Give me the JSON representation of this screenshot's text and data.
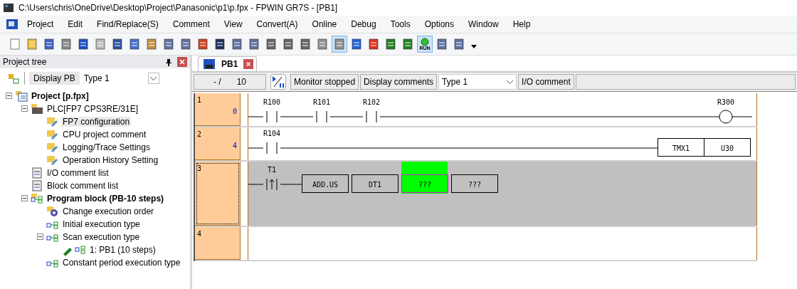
{
  "window": {
    "title": "C:\\Users\\chris\\OneDrive\\Desktop\\Project\\Panasonic\\p1\\p.fpx - FPWIN GR7S - [PB1]"
  },
  "menu": [
    "Project",
    "Edit",
    "Find/Replace(S)",
    "Comment",
    "View",
    "Convert(A)",
    "Online",
    "Debug",
    "Tools",
    "Options",
    "Window",
    "Help"
  ],
  "toolbar": [
    {
      "kind": "new",
      "pressed": false
    },
    {
      "kind": "open",
      "pressed": false
    },
    {
      "kind": "save",
      "pressed": false
    },
    {
      "kind": "print",
      "pressed": false
    },
    {
      "kind": "undo",
      "pressed": false
    },
    {
      "kind": "redo",
      "pressed": false
    },
    {
      "kind": "cut",
      "pressed": false
    },
    {
      "kind": "copy",
      "pressed": false
    },
    {
      "kind": "paste",
      "pressed": false
    },
    {
      "kind": "list",
      "pressed": false
    },
    {
      "kind": "list",
      "pressed": false
    },
    {
      "kind": "swap",
      "pressed": false
    },
    {
      "kind": "find",
      "pressed": false
    },
    {
      "kind": "list",
      "pressed": false
    },
    {
      "kind": "list",
      "pressed": false
    },
    {
      "kind": "grid",
      "pressed": false
    },
    {
      "kind": "grid",
      "pressed": false
    },
    {
      "kind": "grid",
      "pressed": false
    },
    {
      "kind": "device",
      "pressed": false
    },
    {
      "kind": "device",
      "pressed": true
    },
    {
      "kind": "upload",
      "pressed": false
    },
    {
      "kind": "download",
      "pressed": false
    },
    {
      "kind": "monitor",
      "pressed": false
    },
    {
      "kind": "monitor",
      "pressed": false
    },
    {
      "kind": "run",
      "label": "RUN",
      "pressed": true
    },
    {
      "kind": "list",
      "pressed": false
    },
    {
      "kind": "list",
      "pressed": false
    }
  ],
  "project_tree": {
    "title": "Project tree",
    "display_button": "Display PB",
    "type_select": "Type 1",
    "items": [
      {
        "label": "Project [p.fpx]",
        "kind": "project",
        "bold": true,
        "selected": false,
        "expanded": true,
        "children": [
          {
            "label": "PLC[FP7 CPS3RE/31E]",
            "kind": "plc",
            "bold": false,
            "selected": false,
            "expanded": true,
            "children": [
              {
                "label": "FP7 configuration",
                "kind": "config",
                "bold": false,
                "selected": true
              },
              {
                "label": "CPU project comment",
                "kind": "config",
                "bold": false,
                "selected": false
              },
              {
                "label": "Logging/Trace Settings",
                "kind": "config",
                "bold": false,
                "selected": false
              },
              {
                "label": "Operation History Setting",
                "kind": "config",
                "bold": false,
                "selected": false
              }
            ]
          },
          {
            "label": "I/O comment list",
            "kind": "list",
            "bold": false,
            "selected": false
          },
          {
            "label": "Block comment list",
            "kind": "list",
            "bold": false,
            "selected": false
          },
          {
            "label": "Program block (PB-10 steps)",
            "kind": "program",
            "bold": true,
            "selected": false,
            "expanded": true,
            "children": [
              {
                "label": "Change execution order",
                "kind": "gear",
                "bold": false,
                "selected": false
              },
              {
                "label": "Initial execution type",
                "kind": "block",
                "bold": false,
                "selected": false
              },
              {
                "label": "Scan execution type",
                "kind": "block",
                "bold": false,
                "selected": false,
                "expanded": true,
                "children": [
                  {
                    "label": "1: PB1 (10 steps)",
                    "kind": "edit",
                    "bold": false,
                    "selected": false
                  }
                ]
              },
              {
                "label": "Constant period execution type",
                "kind": "block",
                "bold": false,
                "selected": false
              }
            ]
          }
        ]
      }
    ]
  },
  "tabs": [
    {
      "label": "PB1",
      "selected": true
    }
  ],
  "status": {
    "position": "- /",
    "steps": "10",
    "monitor": "Monitor stopped",
    "comments": "Display comments",
    "type_select": "Type 1",
    "comment_kind": "I/O comment"
  },
  "rungs": [
    {
      "number": "1",
      "step": "0",
      "selected": false,
      "contacts": [
        {
          "kind": "contact",
          "label": "R100"
        },
        {
          "kind": "contact",
          "label": "R101"
        },
        {
          "kind": "contact",
          "label": "R102"
        }
      ],
      "output": {
        "kind": "coil",
        "label": "R300"
      }
    },
    {
      "number": "2",
      "step": "4",
      "selected": false,
      "contacts": [
        {
          "kind": "contact",
          "label": "R104"
        }
      ],
      "output": {
        "kind": "box",
        "cells": [
          {
            "text": "TMX1",
            "cursor": false
          },
          {
            "text": "U30",
            "cursor": false
          }
        ]
      }
    },
    {
      "number": "3",
      "selected": true,
      "contacts": [
        {
          "kind": "rising",
          "label": "T1"
        }
      ],
      "output": {
        "kind": "instruction",
        "cells": [
          {
            "text": "ADD.US",
            "cursor": false
          },
          {
            "text": "DT1",
            "cursor": false
          },
          {
            "text": "???",
            "cursor": true
          },
          {
            "text": "???",
            "cursor": false
          }
        ]
      }
    },
    {
      "number": "4",
      "selected": false
    }
  ]
}
